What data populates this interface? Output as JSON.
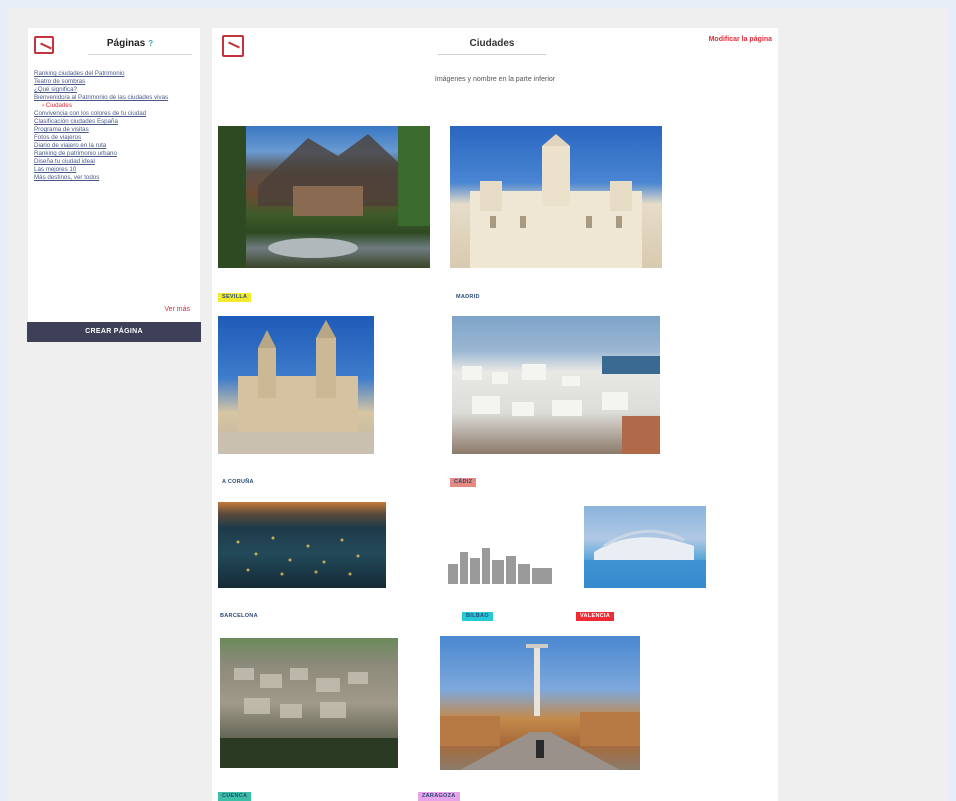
{
  "colors": {
    "accent": "#d42c3a",
    "button_bg": "#3d4057",
    "link": "#4a5a86"
  },
  "sidebar": {
    "title": "Páginas",
    "help_symbol": "?",
    "items": [
      {
        "label": "Ranking ciudades del Patrimonio",
        "current": false
      },
      {
        "label": "Teatro de sombras",
        "current": false
      },
      {
        "label": "¿Qué significa?",
        "current": false
      },
      {
        "label": "Bienvenido/a al Patrimonio de las ciudades vivas",
        "current": false
      },
      {
        "label": "Ciudades",
        "current": true
      },
      {
        "label": "Convivencia con los colores de tu ciudad",
        "current": false
      },
      {
        "label": "Clasificación ciudades España",
        "current": false
      },
      {
        "label": "Programa de visitas",
        "current": false
      },
      {
        "label": "Fotos de viajeros",
        "current": false
      },
      {
        "label": "Diario de viajero en la ruta",
        "current": false
      },
      {
        "label": "Ranking de patrimonio urbano",
        "current": false
      },
      {
        "label": "Diseña tu ciudad ideal",
        "current": false
      },
      {
        "label": "Las mejores 10",
        "current": false
      },
      {
        "label": "Más destinos, ver todos",
        "current": false
      }
    ],
    "more_link": "Ver más",
    "create_button": "CREAR PÁGINA"
  },
  "main": {
    "title": "Ciudades",
    "edit_link": "Modificar la página",
    "subtitle": "Imágenes y nombre en la parte inferior",
    "photos": [
      {
        "name": "photo-mountain-village",
        "subject": "mountain village"
      },
      {
        "name": "photo-madrid-palace",
        "subject": "palace"
      },
      {
        "name": "photo-cathedral",
        "subject": "cathedral"
      },
      {
        "name": "photo-coastal-city",
        "subject": "coastal city"
      },
      {
        "name": "photo-night-city",
        "subject": "city at night"
      },
      {
        "name": "photo-skyline",
        "subject": "skyline"
      },
      {
        "name": "photo-modern-architecture",
        "subject": "modern architecture"
      },
      {
        "name": "photo-hillside-town",
        "subject": "hillside town"
      },
      {
        "name": "photo-bridge-tower",
        "subject": "bridge and tower"
      }
    ],
    "tags": [
      {
        "label": "SEVILLA",
        "color": "#f2ea2a"
      },
      {
        "label": "MADRID",
        "color": "#ffffff"
      },
      {
        "label": "A CORUÑA",
        "color": "#ffffff"
      },
      {
        "label": "CÁDIZ",
        "color": "#e58a80"
      },
      {
        "label": "BARCELONA",
        "color": "#ffffff"
      },
      {
        "label": "BILBAO",
        "color": "#26c9d6"
      },
      {
        "label": "VALENCIA",
        "color": "#ee2b33"
      },
      {
        "label": "CUENCA",
        "color": "#3cbfa6"
      },
      {
        "label": "ZARAGOZA",
        "color": "#e7a4e9"
      }
    ]
  }
}
